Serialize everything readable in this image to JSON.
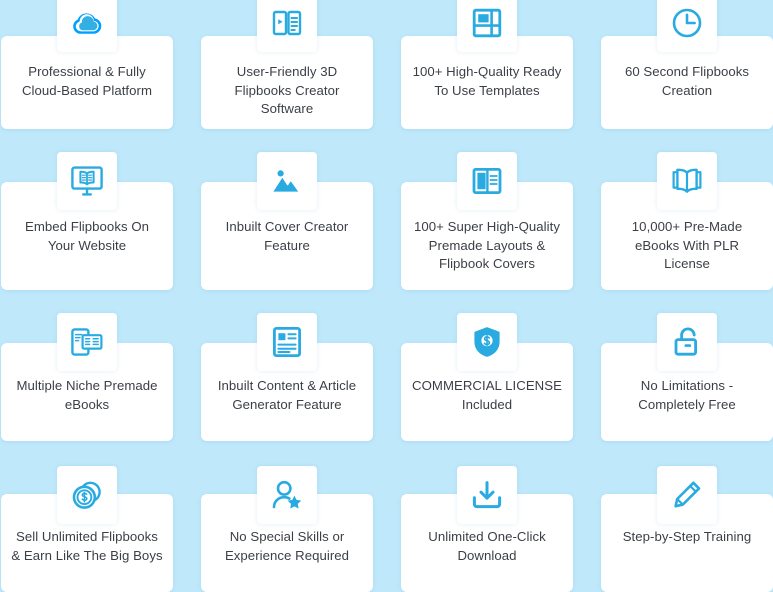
{
  "page": {
    "background_color": "#bfe9fb",
    "card_color": "#ffffff",
    "icon_color": "#29abe2",
    "icon_accent_color": "#00a0ff",
    "text_color": "#3b3f46",
    "columns": 4,
    "rows": 4
  },
  "features": [
    {
      "id": "professional-fully-cloud-based-platform",
      "title": "Professional & Fully Cloud-Based Platform",
      "icon": "cloud-icon"
    },
    {
      "id": "user-friendly-3d-flipbooks-creator-software",
      "title": "User-Friendly 3D Flipbooks Creator Software",
      "icon": "flipbook-play-icon"
    },
    {
      "id": "high-quality-ready-to-use-templates",
      "title": "100+ High-Quality Ready To Use Templates",
      "icon": "layout-template-icon"
    },
    {
      "id": "60-second-flipbooks-creation",
      "title": "60 Second Flipbooks Creation",
      "icon": "clock-icon"
    },
    {
      "id": "embed-flipbooks-on-your-website",
      "title": "Embed Flipbooks On Your Website",
      "icon": "monitor-book-icon"
    },
    {
      "id": "inbuilt-cover-creator-feature",
      "title": "Inbuilt Cover Creator Feature",
      "icon": "image-mountain-icon"
    },
    {
      "id": "super-high-quality-premade-layouts",
      "title": "100+ Super High-Quality Premade Layouts & Flipbook Covers",
      "icon": "two-column-layout-icon"
    },
    {
      "id": "pre-made-ebooks-with-plr-license",
      "title": "10,000+ Pre-Made eBooks With PLR License",
      "icon": "open-book-icon"
    },
    {
      "id": "multiple-niche-premade-ebooks",
      "title": "Multiple Niche Premade eBooks",
      "icon": "mobile-documents-icon"
    },
    {
      "id": "inbuilt-content-article-generator-feature",
      "title": "Inbuilt Content & Article Generator Feature",
      "icon": "article-document-icon"
    },
    {
      "id": "commercial-license-included",
      "title": "COMMERCIAL LICENSE Included",
      "icon": "shield-dollar-icon"
    },
    {
      "id": "no-limitations-completely-free",
      "title": "No Limitations - Completely Free",
      "icon": "unlock-icon"
    },
    {
      "id": "sell-unlimited-flipbooks",
      "title": "Sell Unlimited Flipbooks & Earn Like The Big Boys",
      "icon": "coins-dollar-icon"
    },
    {
      "id": "no-special-skills-required",
      "title": "No Special Skills or Experience Required",
      "icon": "user-star-icon"
    },
    {
      "id": "unlimited-one-click-download",
      "title": "Unlimited One-Click Download",
      "icon": "download-icon"
    },
    {
      "id": "step-by-step-training",
      "title": "Step-by-Step Training",
      "icon": "pencil-icon"
    }
  ]
}
